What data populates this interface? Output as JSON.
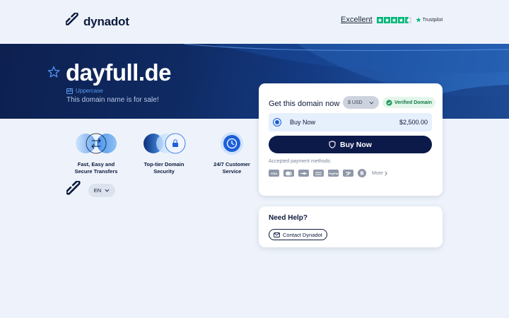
{
  "header": {
    "brand": "dynadot",
    "trust_rating": "Excellent",
    "trust_brand": "Trustpilot"
  },
  "hero": {
    "domain": "dayfull.de",
    "case_tag": "Uppercase",
    "subtitle": "This domain name is for sale!"
  },
  "features": [
    {
      "icon": "transfer-icon",
      "label_line1": "Fast, Easy and",
      "label_line2": "Secure Transfers"
    },
    {
      "icon": "lock-icon",
      "label_line1": "Top-tier Domain",
      "label_line2": "Security"
    },
    {
      "icon": "clock-icon",
      "label_line1": "24/7 Customer",
      "label_line2": "Service"
    }
  ],
  "language": "EN",
  "purchase": {
    "title": "Get this domain now",
    "currency": "$ USD",
    "verified": "Verified Domain",
    "option_label": "Buy Now",
    "option_price": "$2,500.00",
    "buy_button": "Buy Now",
    "payment_label": "Accepted payment methods:",
    "payment_methods": [
      "VISA",
      "MC",
      "DISC",
      "AMEX",
      "PayPal",
      "Alipay",
      "BTC"
    ],
    "more": "More"
  },
  "help": {
    "title": "Need Help?",
    "contact": "Contact Dynadot"
  },
  "colors": {
    "navy": "#0c1a3d",
    "button": "#0c1a4a",
    "accent_blue": "#1d5fd8",
    "trustpilot_green": "#00b67a",
    "verified_green": "#117a46",
    "background": "#eef3fb"
  }
}
